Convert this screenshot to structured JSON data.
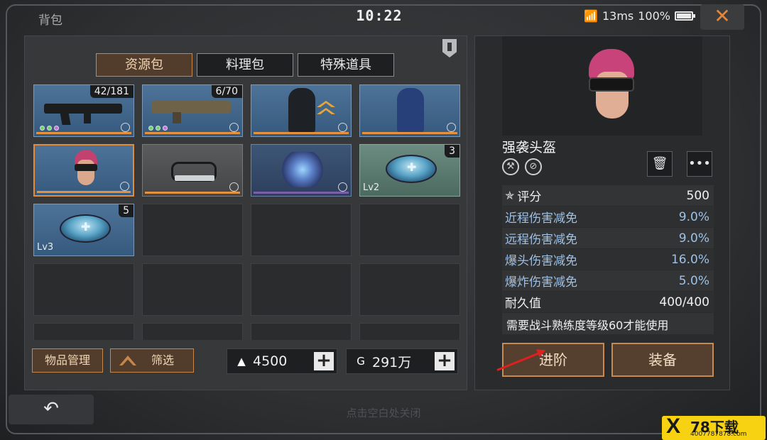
{
  "header": {
    "title": "背包",
    "clock": "10:22",
    "ping": "13ms",
    "battery": "100%",
    "close_glyph": "✕"
  },
  "tabs": [
    {
      "label": "资源包",
      "active": true
    },
    {
      "label": "料理包",
      "active": false
    },
    {
      "label": "特殊道具",
      "active": false
    }
  ],
  "grid": {
    "items": [
      {
        "name": "rifle",
        "style": "blue",
        "count": "42/181",
        "quality_dots": [
          "#6fd36f",
          "#6fd36f",
          "#c86fe0"
        ]
      },
      {
        "name": "shotgun",
        "style": "blue",
        "count": "6/70",
        "quality_dots": [
          "#6fd36f",
          "#6fd36f",
          "#c86fe0"
        ]
      },
      {
        "name": "hooded-outfit",
        "style": "blue",
        "upgrade": true
      },
      {
        "name": "armor-suit",
        "style": "blue"
      },
      {
        "name": "assault-helmet",
        "style": "blue",
        "selected": true
      },
      {
        "name": "goggles",
        "style": "grey"
      },
      {
        "name": "crystal",
        "style": "purple"
      },
      {
        "name": "supply-pack-lv2",
        "style": "green",
        "count": "3",
        "level": "Lv2"
      },
      {
        "name": "supply-pack-lv3",
        "style": "blue",
        "count": "5",
        "level": "Lv3"
      }
    ]
  },
  "bottom": {
    "manage_label": "物品管理",
    "filter_label": "筛选",
    "currency1": {
      "icon": "▲",
      "value": "4500"
    },
    "currency2": {
      "icon": "G",
      "value": "291万"
    },
    "plus": "+"
  },
  "detail": {
    "name": "强袭头盔",
    "stats": [
      {
        "label": "评分",
        "value": "500",
        "style": "white",
        "icon": true
      },
      {
        "label": "近程伤害减免",
        "value": "9.0%",
        "style": "blue"
      },
      {
        "label": "远程伤害减免",
        "value": "9.0%",
        "style": "blue"
      },
      {
        "label": "爆头伤害减免",
        "value": "16.0%",
        "style": "blue"
      },
      {
        "label": "爆炸伤害减免",
        "value": "5.0%",
        "style": "blue"
      },
      {
        "label": "耐久值",
        "value": "400/400",
        "style": "white"
      }
    ],
    "requirement": "需要战斗熟练度等级60才能使用",
    "advance_label": "进阶",
    "equip_label": "装备",
    "trash_glyph": "🗑",
    "more_glyph": "•••"
  },
  "footer": {
    "back_glyph": "↶",
    "hint": "点击空白处关闭"
  },
  "watermark": {
    "logo": "X",
    "name": "78下载",
    "url": "4007787878.com"
  },
  "colors": {
    "accent": "#c7874a",
    "blue_stat": "#9ec1e6",
    "arrow": "#e02020"
  }
}
